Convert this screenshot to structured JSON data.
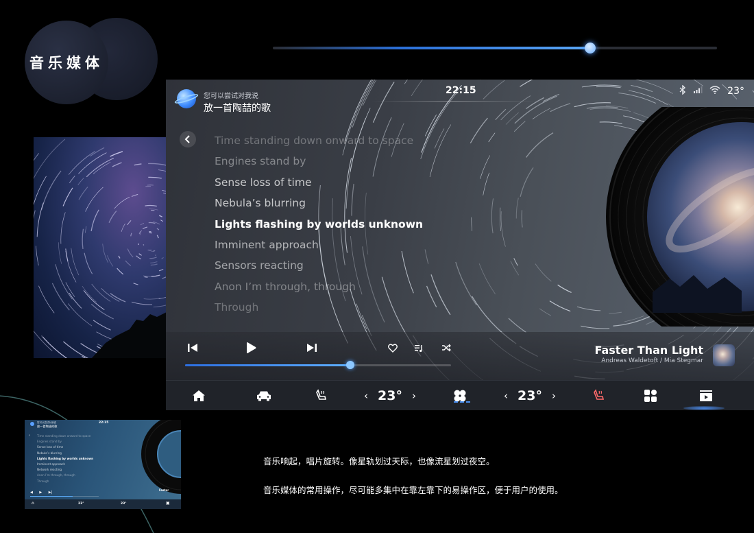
{
  "section_title": "音乐媒体",
  "top_slider": {
    "value": 0.715
  },
  "status_bar": {
    "time": "22:15",
    "temperature": "23°"
  },
  "assistant": {
    "hint": "您可以尝试对我说",
    "command": "放一首陶喆的歌"
  },
  "lyrics": [
    {
      "text": "Time standing down onward to space",
      "opacity": 0.3,
      "bold": false
    },
    {
      "text": "Engines stand by",
      "opacity": 0.4,
      "bold": false
    },
    {
      "text": "Sense loss of time",
      "opacity": 0.72,
      "bold": false
    },
    {
      "text": "Nebula’s blurring",
      "opacity": 0.72,
      "bold": false
    },
    {
      "text": "Lights flashing by worlds unknown",
      "opacity": 1.0,
      "bold": true
    },
    {
      "text": "Imminent approach",
      "opacity": 0.62,
      "bold": false
    },
    {
      "text": "Sensors reacting",
      "opacity": 0.55,
      "bold": false
    },
    {
      "text": "Anon I’m through, through",
      "opacity": 0.38,
      "bold": false
    },
    {
      "text": "Through",
      "opacity": 0.3,
      "bold": false
    }
  ],
  "now_playing": {
    "title": "Faster Than Light",
    "artist": "Andreas Waldetoft / Mia Stegmar",
    "progress": 0.62
  },
  "icons": {
    "prev": "skip-previous-icon",
    "play": "play-icon",
    "next": "skip-next-icon",
    "favorite": "heart-icon",
    "playlist": "playlist-icon",
    "shuffle": "shuffle-icon"
  },
  "dock": {
    "driver_temp": "23°",
    "passenger_temp": "23°",
    "active": "media"
  },
  "thumbnail": {
    "hint": "您可以尝试对我说",
    "command": "放一首陶喆的歌",
    "time": "22:15",
    "lyrics": [
      "Time standing down onward to space",
      "Engines stand by",
      "Sense loss of time",
      "Nebula’s blurring",
      "Lights flashing by worlds unknown",
      "Imminent approach",
      "Network reacting",
      "Anon I’m through, through",
      "Through"
    ],
    "song_short": "Faster",
    "driver_temp": "23°",
    "passenger_temp": "23°"
  },
  "captions": [
    "音乐响起，唱片旋转。像星轨划过天际，也像流星划过夜空。",
    "音乐媒体的常用操作，尽可能多集中在靠左靠下的易操作区，便于用户的使用。"
  ],
  "colors": {
    "accent": "#4a8ff0",
    "background": "#000000"
  }
}
